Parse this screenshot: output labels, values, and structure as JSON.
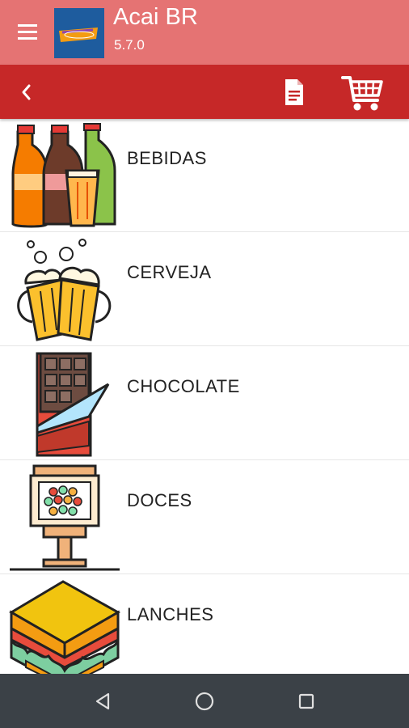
{
  "app": {
    "title": "Acai BR",
    "version": "5.7.0"
  },
  "icons": {
    "menu": "menu-icon",
    "back": "chevron-left-icon",
    "document": "document-icon",
    "cart": "cart-icon"
  },
  "colors": {
    "appbar": "#e57373",
    "toolbar": "#c62828",
    "navbar": "#3b4147"
  },
  "categories": [
    {
      "label": "BEBIDAS",
      "icon": "soda-bottles-icon"
    },
    {
      "label": "CERVEJA",
      "icon": "beer-mugs-icon"
    },
    {
      "label": "CHOCOLATE",
      "icon": "chocolate-bar-icon"
    },
    {
      "label": "DOCES",
      "icon": "candy-machine-icon"
    },
    {
      "label": "LANCHES",
      "icon": "sandwich-icon"
    }
  ]
}
